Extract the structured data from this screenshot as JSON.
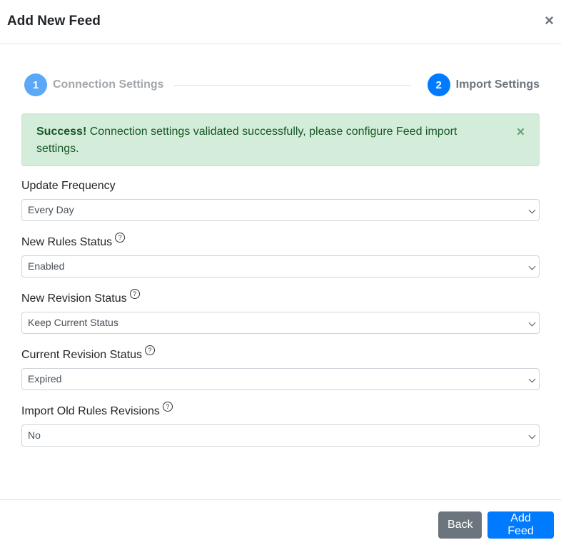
{
  "modal": {
    "title": "Add New Feed",
    "close_icon": "×"
  },
  "stepper": {
    "steps": [
      {
        "number": "1",
        "label": "Connection Settings",
        "state": "completed",
        "color": "#5aa8f7"
      },
      {
        "number": "2",
        "label": "Import Settings",
        "state": "active",
        "color": "#007bff"
      }
    ]
  },
  "alert": {
    "strong": "Success!",
    "message": " Connection settings validated successfully, please configure Feed import settings.",
    "close_icon": "×",
    "color": "#d4edda"
  },
  "fields": [
    {
      "label": "Update Frequency",
      "value": "Every Day",
      "help": false
    },
    {
      "label": "New Rules Status",
      "value": "Enabled",
      "help": true
    },
    {
      "label": "New Revision Status",
      "value": "Keep Current Status",
      "help": true
    },
    {
      "label": "Current Revision Status",
      "value": "Expired",
      "help": true
    },
    {
      "label": "Import Old Rules Revisions",
      "value": "No",
      "help": true
    }
  ],
  "help_icon": "?",
  "footer": {
    "back_label": "Back",
    "add_label": "Add Feed"
  }
}
